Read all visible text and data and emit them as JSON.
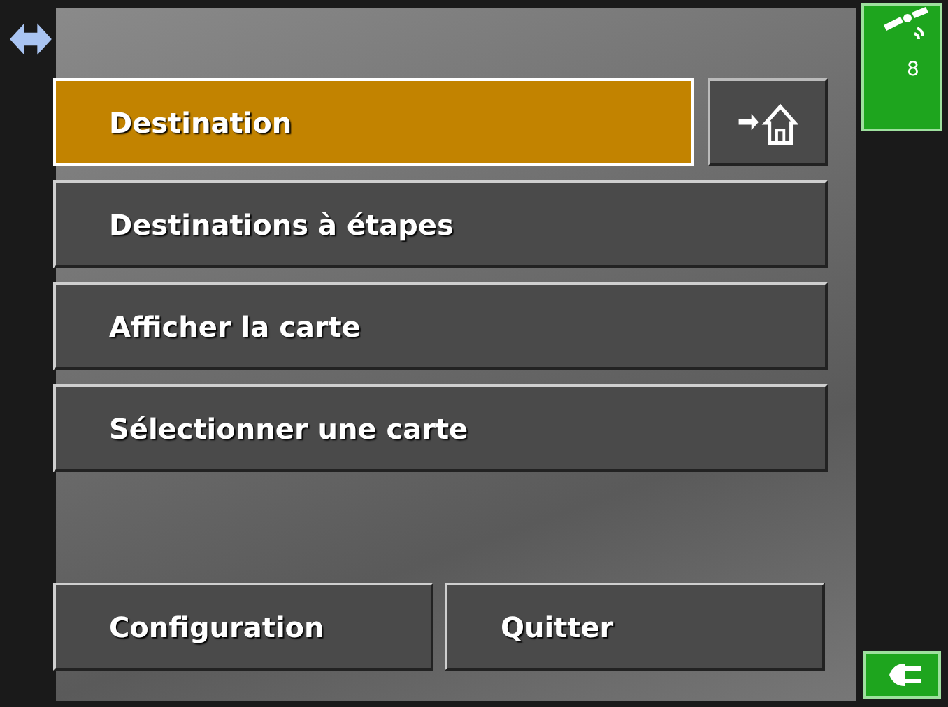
{
  "gps": {
    "satellites": "8"
  },
  "menu": [
    {
      "label": "Destination",
      "selected": true
    },
    {
      "label": "Destinations à étapes",
      "selected": false
    },
    {
      "label": "Afficher la carte",
      "selected": false
    },
    {
      "label": "Sélectionner une carte",
      "selected": false
    }
  ],
  "bottom_buttons": [
    {
      "label": "Configuration",
      "selected": false
    },
    {
      "label": "Quitter",
      "selected": false
    }
  ]
}
